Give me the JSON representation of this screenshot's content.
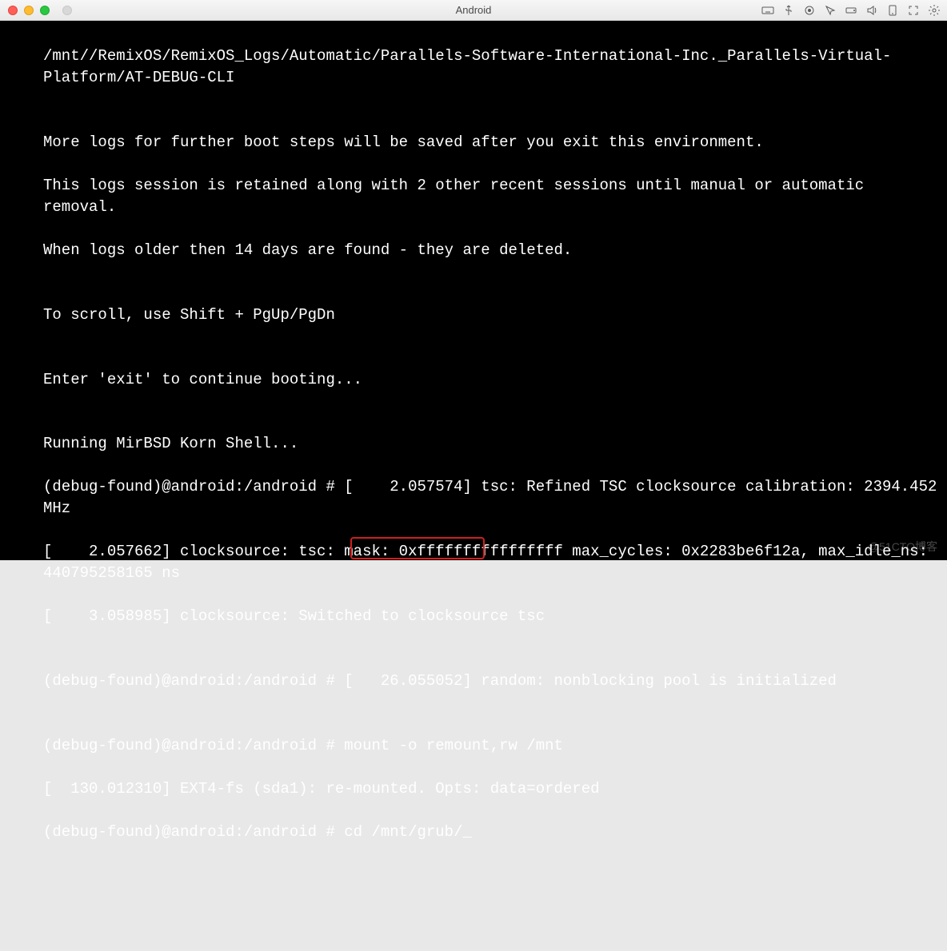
{
  "window": {
    "title": "Android"
  },
  "terminal": {
    "lines": [
      "/mnt//RemixOS/RemixOS_Logs/Automatic/Parallels-Software-International-Inc._Parallels-Virtual-Platform/AT-DEBUG-CLI",
      "",
      "More logs for further boot steps will be saved after you exit this environment.",
      "This logs session is retained along with 2 other recent sessions until manual or automatic removal.",
      "When logs older then 14 days are found - they are deleted.",
      "",
      "To scroll, use Shift + PgUp/PgDn",
      "",
      "Enter 'exit' to continue booting...",
      "",
      "Running MirBSD Korn Shell...",
      "(debug-found)@android:/android # [    2.057574] tsc: Refined TSC clocksource calibration: 2394.452 MHz",
      "[    2.057662] clocksource: tsc: mask: 0xffffffffffffffff max_cycles: 0x2283be6f12a, max_idle_ns: 440795258165 ns",
      "[    3.058985] clocksource: Switched to clocksource tsc",
      "",
      "(debug-found)@android:/android # [   26.055052] random: nonblocking pool is initialized",
      "",
      "(debug-found)@android:/android # mount -o remount,rw /mnt",
      "[  130.012310] EXT4-fs (sda1): re-mounted. Opts: data=ordered",
      "(debug-found)@android:/android # cd /mnt/grub/_"
    ],
    "highlighted_command": "cd /mnt/grub/"
  },
  "watermark": "@51CTO博客",
  "toolbar_icons": [
    "keyboard-icon",
    "usb-icon",
    "target-icon",
    "cursor-icon",
    "drive-icon",
    "sound-icon",
    "tablet-icon",
    "expand-icon",
    "gear-icon"
  ]
}
